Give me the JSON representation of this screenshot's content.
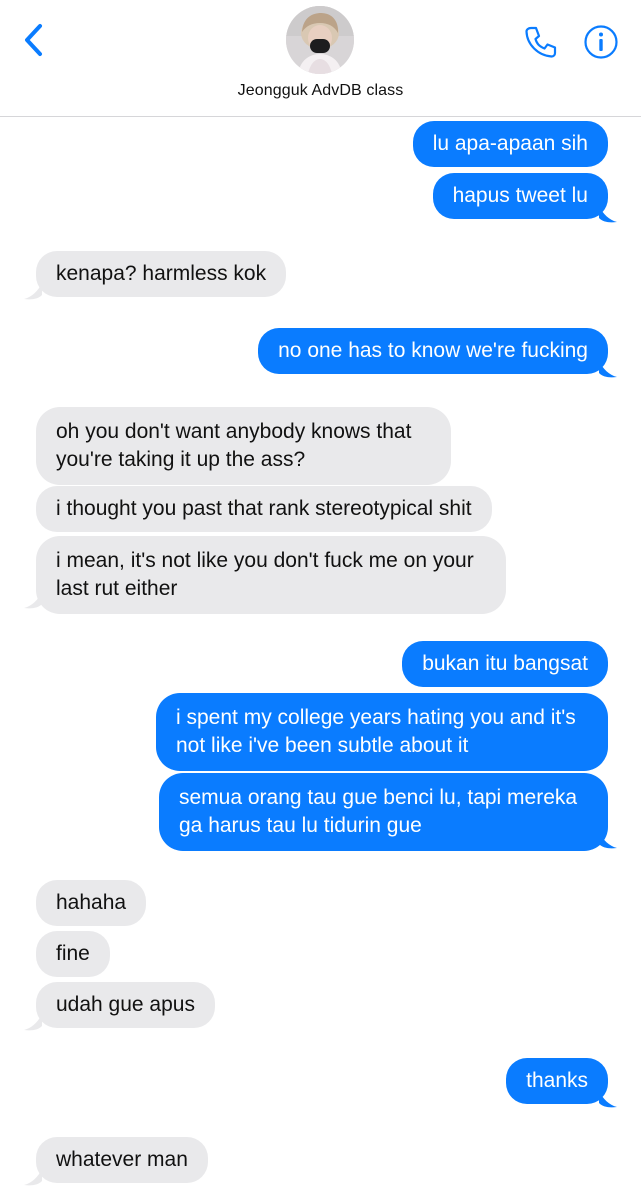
{
  "header": {
    "contact_name": "Jeongguk AdvDB class",
    "back_icon": "chevron-left-icon",
    "call_icon": "phone-icon",
    "info_icon": "info-icon",
    "accent_color": "#0a7cff"
  },
  "messages": [
    {
      "from": "me",
      "lines": [
        "lu apa-apaan sih"
      ]
    },
    {
      "from": "me",
      "lines": [
        "hapus tweet lu"
      ]
    },
    {
      "from": "them",
      "lines": [
        "kenapa? harmless kok"
      ]
    },
    {
      "from": "me",
      "lines": [
        "no one has to know we're fucking"
      ]
    },
    {
      "from": "them",
      "lines": [
        "oh you don't want anybody knows that",
        "you're taking it up the ass?"
      ]
    },
    {
      "from": "them",
      "lines": [
        "i thought you past that rank stereotypical shit"
      ]
    },
    {
      "from": "them",
      "lines": [
        "i mean, it's not like you don't fuck me on your",
        "last rut either"
      ]
    },
    {
      "from": "me",
      "lines": [
        "bukan itu bangsat"
      ]
    },
    {
      "from": "me",
      "lines": [
        "i spent my college years hating you and it's",
        "not like i've been subtle about it"
      ]
    },
    {
      "from": "me",
      "lines": [
        "semua orang tau gue benci lu, tapi mereka",
        "ga harus tau lu tidurin gue"
      ]
    },
    {
      "from": "them",
      "lines": [
        "hahaha"
      ]
    },
    {
      "from": "them",
      "lines": [
        "fine"
      ]
    },
    {
      "from": "them",
      "lines": [
        "udah gue apus"
      ]
    },
    {
      "from": "me",
      "lines": [
        "thanks"
      ]
    },
    {
      "from": "them",
      "lines": [
        "whatever man"
      ]
    }
  ]
}
